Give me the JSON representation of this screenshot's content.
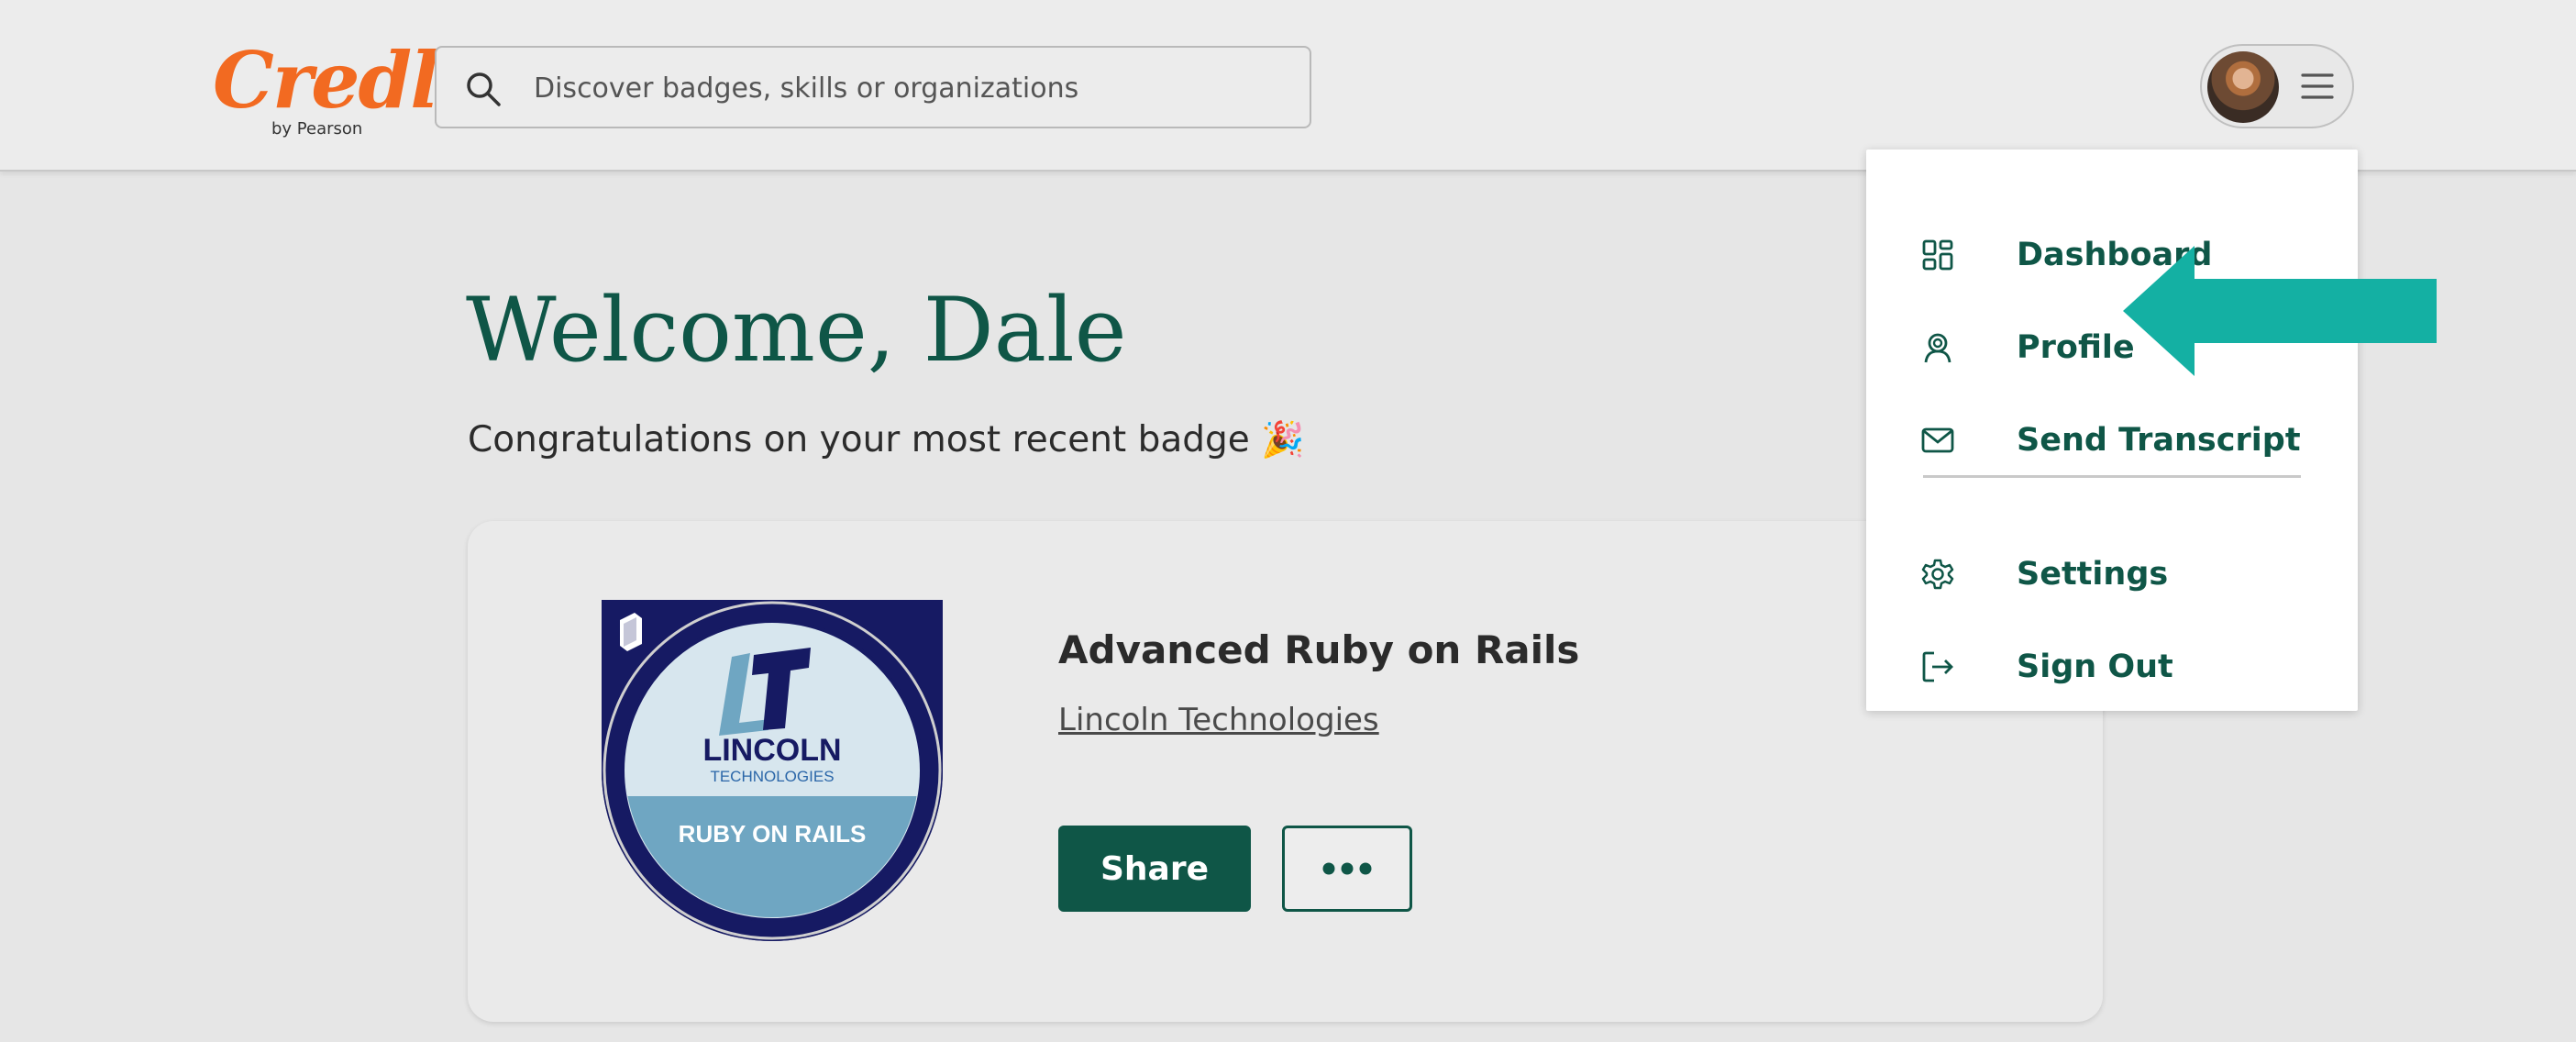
{
  "header": {
    "logo_text": "Credly",
    "logo_subtext": "by Pearson",
    "search_placeholder": "Discover badges, skills or organizations"
  },
  "main": {
    "welcome": "Welcome, Dale",
    "congrats": "Congratulations on your most recent badge"
  },
  "badge_card": {
    "title": "Advanced Ruby on Rails",
    "issuer": "Lincoln Technologies",
    "share_label": "Share",
    "badge_image": {
      "logo_letters": "LT",
      "org_line1": "LINCOLN",
      "org_line2": "TECHNOLOGIES",
      "band_text": "RUBY ON RAILS"
    }
  },
  "account_menu": {
    "items": [
      {
        "label": "Dashboard",
        "icon": "dashboard-icon"
      },
      {
        "label": "Profile",
        "icon": "profile-icon"
      },
      {
        "label": "Send Transcript",
        "icon": "mail-icon"
      },
      {
        "label": "Settings",
        "icon": "gear-icon"
      },
      {
        "label": "Sign Out",
        "icon": "sign-out-icon"
      }
    ]
  },
  "colors": {
    "brand_orange": "#f26a21",
    "primary_green": "#0f5647",
    "annotation_teal": "#14b0a3",
    "badge_navy": "#161a63",
    "badge_blue": "#6fa6c2"
  }
}
